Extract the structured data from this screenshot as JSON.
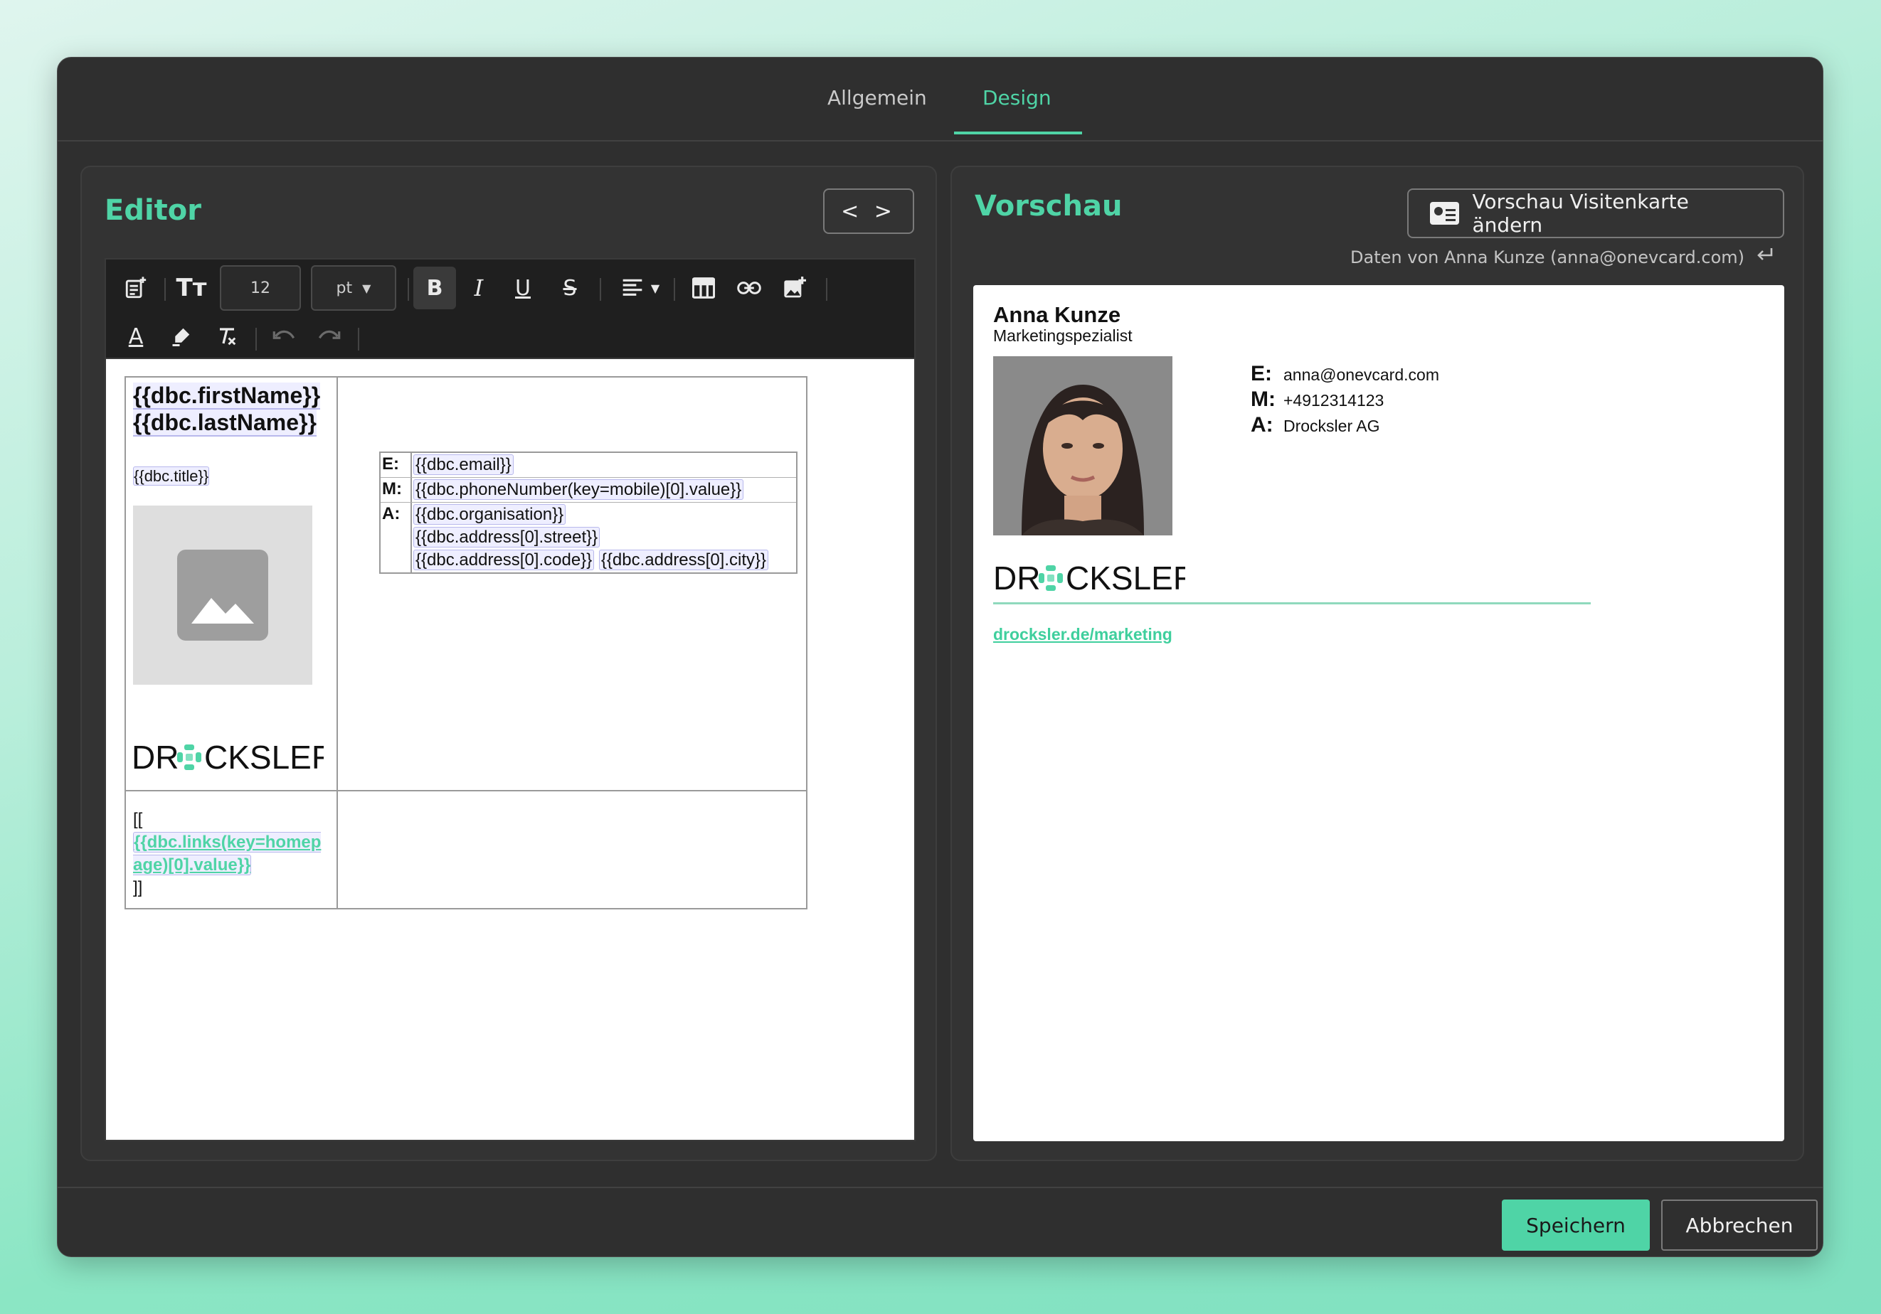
{
  "tabs": {
    "general": "Allgemein",
    "design": "Design"
  },
  "editor": {
    "title": "Editor",
    "code_toggle": "< >",
    "toolbar": {
      "font_size": "12",
      "unit": "pt"
    },
    "template": {
      "name_first": "{{dbc.firstName}}",
      "name_last": "{{dbc.lastName}}",
      "title": "{{dbc.title}}",
      "contact_rows": [
        {
          "label": "E:",
          "values": [
            "{{dbc.email}}"
          ]
        },
        {
          "label": "M:",
          "values": [
            "{{dbc.phoneNumber(key=mobile)[0].value}}"
          ]
        },
        {
          "label": "A:",
          "values": [
            "{{dbc.organisation}}",
            "{{dbc.address[0].street}}",
            "{{dbc.address[0].code}}",
            "{{dbc.address[0].city}}"
          ]
        }
      ],
      "link_open": "[[",
      "link": "{{dbc.links(key=homepage)[0].value}}",
      "link_close": "]]"
    }
  },
  "preview": {
    "title": "Vorschau",
    "change_button": "Vorschau Visitenkarte ändern",
    "data_from": "Daten von Anna Kunze (anna@onevcard.com)",
    "card": {
      "name": "Anna Kunze",
      "job_title": "Marketingspezialist",
      "contact": [
        {
          "label": "E:",
          "value": "anna@onevcard.com"
        },
        {
          "label": "M:",
          "value": "+4912314123"
        },
        {
          "label": "A:",
          "value": "Drocksler AG"
        }
      ],
      "link": "drocksler.de/marketing"
    }
  },
  "logo": {
    "text": "DROCKSLER",
    "accent_color": "#4fd4a6"
  },
  "footer": {
    "save": "Speichern",
    "cancel": "Abbrechen"
  },
  "colors": {
    "accent": "#4fd4a6",
    "panel": "#333333",
    "modal": "#2f2f2f"
  }
}
